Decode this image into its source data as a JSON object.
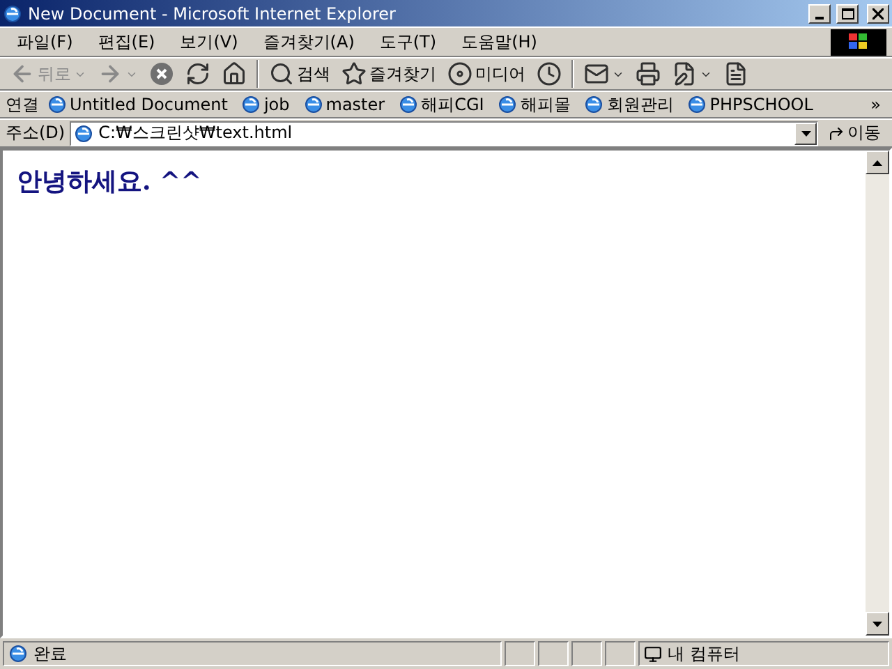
{
  "window": {
    "title": "New Document - Microsoft Internet Explorer"
  },
  "menu": [
    {
      "label": "파일(F)"
    },
    {
      "label": "편집(E)"
    },
    {
      "label": "보기(V)"
    },
    {
      "label": "즐겨찾기(A)"
    },
    {
      "label": "도구(T)"
    },
    {
      "label": "도움말(H)"
    }
  ],
  "toolbar": [
    {
      "kind": "back",
      "label": "뒤로",
      "disabled": true,
      "dropdown": true
    },
    {
      "kind": "forward",
      "disabled": true,
      "dropdown": true
    },
    {
      "kind": "stop",
      "disabled": false,
      "dropdown": false
    },
    {
      "kind": "refresh",
      "disabled": false,
      "dropdown": false
    },
    {
      "kind": "home",
      "disabled": false,
      "dropdown": false
    },
    {
      "kind": "separator"
    },
    {
      "kind": "search",
      "label": "검색",
      "disabled": false,
      "dropdown": false
    },
    {
      "kind": "favorites",
      "label": "즐겨찾기",
      "disabled": false,
      "dropdown": false
    },
    {
      "kind": "media",
      "label": "미디어",
      "disabled": false,
      "dropdown": false
    },
    {
      "kind": "history",
      "disabled": false,
      "dropdown": false
    },
    {
      "kind": "separator"
    },
    {
      "kind": "mail",
      "disabled": false,
      "dropdown": true
    },
    {
      "kind": "print",
      "disabled": false,
      "dropdown": false
    },
    {
      "kind": "edit",
      "disabled": false,
      "dropdown": true
    },
    {
      "kind": "discuss",
      "disabled": false,
      "dropdown": false
    }
  ],
  "links_bar": {
    "label": "연결",
    "links": [
      {
        "label": "Untitled Document"
      },
      {
        "label": "job"
      },
      {
        "label": "master"
      },
      {
        "label": "해피CGI"
      },
      {
        "label": "해피몰"
      },
      {
        "label": "회원관리"
      },
      {
        "label": "PHPSCHOOL"
      }
    ],
    "more": "»"
  },
  "address_bar": {
    "label": "주소(D)",
    "value": "C:₩스크린샷₩text.html",
    "go": "이동"
  },
  "page": {
    "heading": "안녕하세요. ^^"
  },
  "status_bar": {
    "text": "완료",
    "zone": "내 컴퓨터"
  }
}
